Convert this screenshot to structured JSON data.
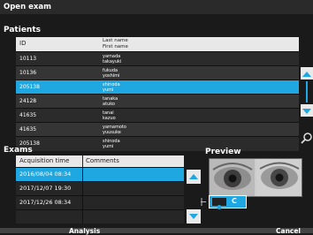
{
  "window_title": "Open exam",
  "patients": {
    "section_label": "Patients",
    "col_id": "ID",
    "col_last": "Last name",
    "col_first": "First name",
    "rows": [
      {
        "id": "10113",
        "last": "yamada",
        "first": "takayuki"
      },
      {
        "id": "10136",
        "last": "fukuda",
        "first": "yoshimi"
      },
      {
        "id": "205138",
        "last": "shinoda",
        "first": "yumi"
      },
      {
        "id": "24128",
        "last": "tanaka",
        "first": "atuko"
      },
      {
        "id": "41635",
        "last": "tanai",
        "first": "kazuo"
      },
      {
        "id": "41635",
        "last": "yamamoto",
        "first": "yuusuke"
      },
      {
        "id": "205138",
        "last": "shinoda",
        "first": "yumi"
      }
    ],
    "selected_index": 2
  },
  "exams": {
    "section_label": "Exams",
    "col_time": "Acquisition time",
    "col_comments": "Comments",
    "rows": [
      {
        "time": "2016/08/04 08:34",
        "comment": ""
      },
      {
        "time": "2017/12/07 19:30",
        "comment": ""
      },
      {
        "time": "2017/12/26 08:34",
        "comment": ""
      }
    ],
    "selected_index": 0
  },
  "preview": {
    "section_label": "Preview",
    "toggle_label": "C"
  },
  "footer": {
    "analysis_label": "Analysis",
    "cancel_label": "Cancel"
  },
  "colors": {
    "accent": "#1ea7e0",
    "background": "#1a1a1a",
    "header_bg": "#e8e8e8"
  }
}
